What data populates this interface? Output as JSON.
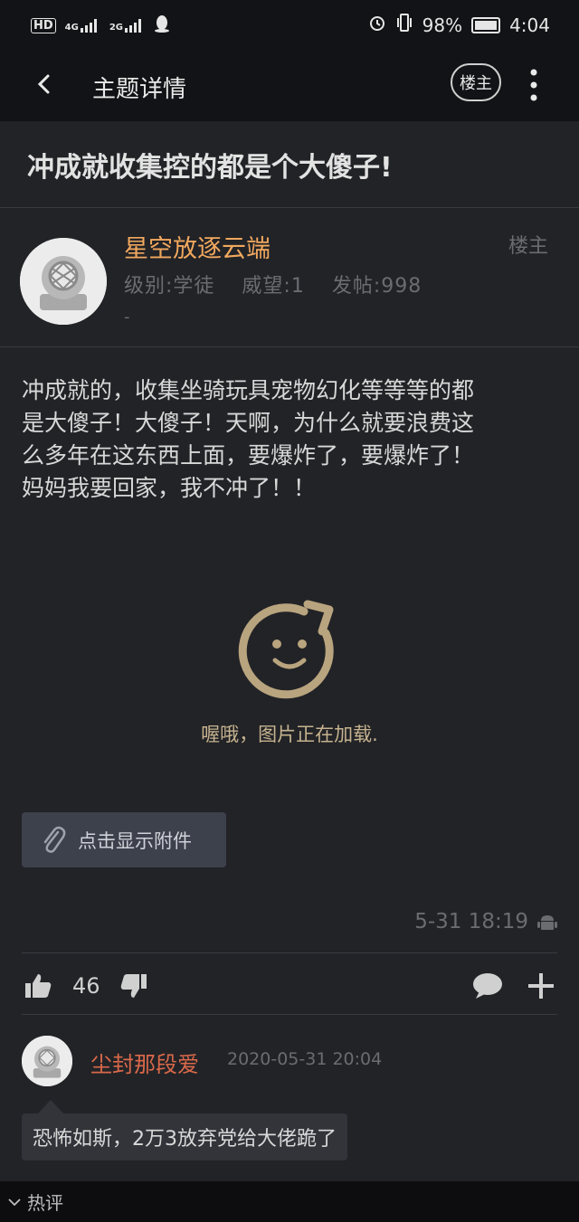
{
  "status_bar": {
    "left_indicators": [
      "HD",
      "4G",
      "2G"
    ],
    "battery": "98%",
    "time": "4:04",
    "icons": [
      "hd-icon",
      "signal-4g-icon",
      "signal-2g-icon",
      "qq-icon",
      "alarm-icon",
      "vibrate-icon",
      "battery-icon"
    ]
  },
  "app_bar": {
    "title": "主题详情",
    "lz_button": "楼主",
    "icons": [
      "back-icon",
      "more-vertical-icon"
    ]
  },
  "topic": {
    "title": "冲成就收集控的都是个大傻子!"
  },
  "poster": {
    "name": "星空放逐云端",
    "level": "级别:学徒",
    "prestige": "威望:1",
    "posts": "发帖:998",
    "dash": "-",
    "tag": "楼主"
  },
  "post": {
    "lines": [
      "冲成就的，收集坐骑玩具宠物幻化等等等的都",
      "是大傻子！大傻子！天啊，为什么就要浪费这",
      "么多年在这东西上面，要爆炸了，要爆炸了！",
      "妈妈我要回家，我不冲了！！"
    ],
    "loading_text": "喔哦，图片正在加载.",
    "attach_button": "点击显示附件",
    "time": "5-31 18:19",
    "likes": "46"
  },
  "comment": {
    "user": "尘封那段爱",
    "time": "2020-05-31 20:04",
    "text": "恐怖如斯，2万3放弃党给大佬跪了"
  },
  "bottom_bar": {
    "label": "热评"
  },
  "colors": {
    "background": "#222327",
    "bar": "#121316",
    "poster_name": "#f1a85e",
    "commenter_name": "#d9694a",
    "loading_accent": "#c6b38f"
  }
}
